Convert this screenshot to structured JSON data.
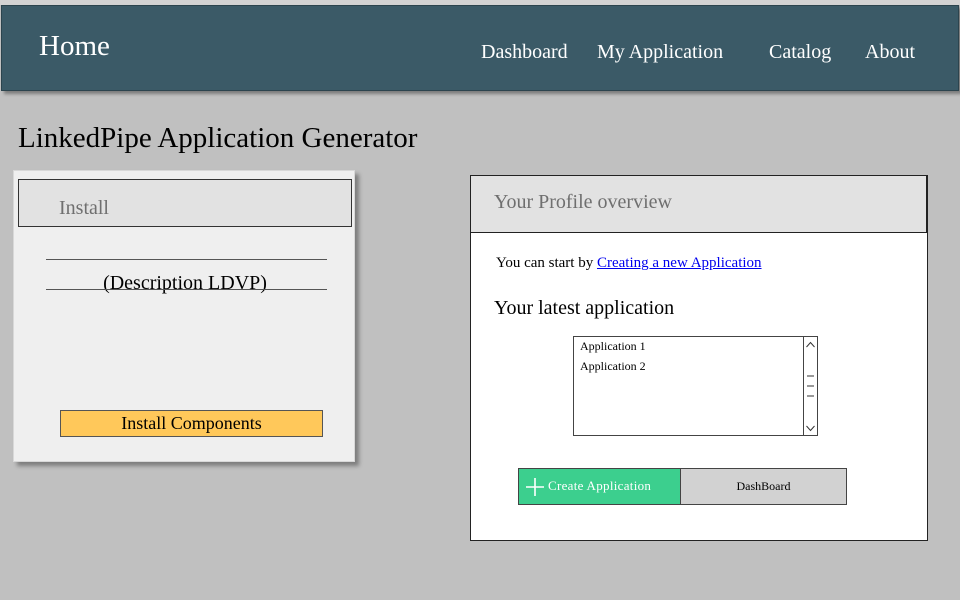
{
  "nav": {
    "home": "Home",
    "links": [
      "Dashboard",
      "My Application",
      "Catalog",
      "About"
    ]
  },
  "page": {
    "title": "LinkedPipe Application Generator"
  },
  "install_panel": {
    "header": "Install",
    "description": "(Description LDVP)",
    "button_label": "Install Components"
  },
  "profile_panel": {
    "header": "Your Profile overview",
    "start_prefix": "You can start by ",
    "start_link": "Creating a new Application",
    "latest_title": "Your latest application",
    "applications": [
      "Application 1",
      "Application 2"
    ],
    "create_button": "Create  Application",
    "dashboard_button": "DashBoard"
  },
  "icons": {
    "create": "plus-icon",
    "scroll_up": "chevron-up-icon",
    "scroll_down": "chevron-down-icon",
    "scroll_grip": "grip-lines-icon"
  },
  "colors": {
    "navbar": "#3b5a67",
    "background": "#c0c0c0",
    "install_button": "#ffc85a",
    "create_button": "#3ccf8e",
    "link": "#0000ee"
  }
}
